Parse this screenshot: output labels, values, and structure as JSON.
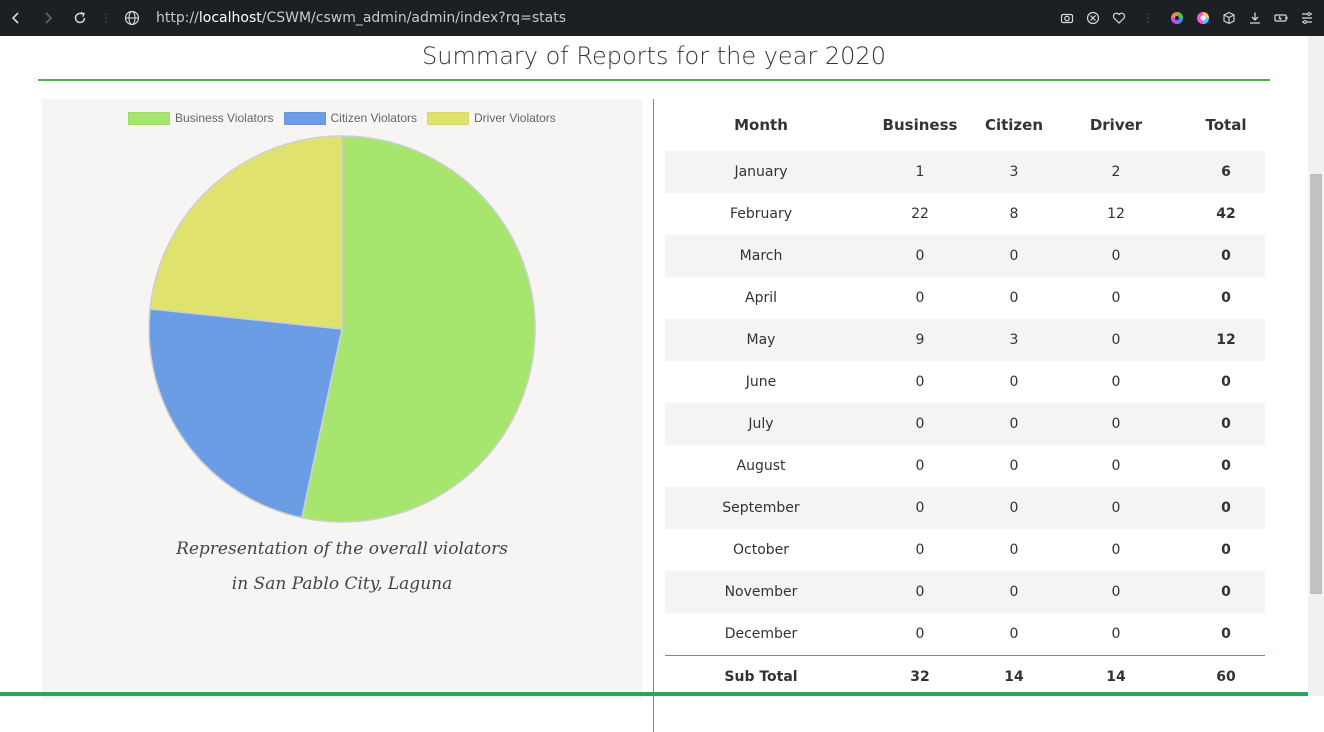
{
  "browser": {
    "url_prefix": "http://",
    "url_host": "localhost",
    "url_path": "/CSWM/cswm_admin/admin/index?rq=stats"
  },
  "page": {
    "title": "Summary of Reports for the year 2020",
    "caption_line1": "Representation of the overall violators",
    "caption_line2": "in San Pablo City, Laguna"
  },
  "chart_data": {
    "type": "pie",
    "categories": [
      "Business Violators",
      "Citizen Violators",
      "Driver Violators"
    ],
    "values": [
      32,
      14,
      14
    ],
    "colors": [
      "#a6e56e",
      "#6b9de4",
      "#dfe36e"
    ],
    "legend": "top",
    "title": ""
  },
  "table": {
    "headers": [
      "Month",
      "Business",
      "Citizen",
      "Driver",
      "Total"
    ],
    "rows": [
      [
        "January",
        "1",
        "3",
        "2",
        "6"
      ],
      [
        "February",
        "22",
        "8",
        "12",
        "42"
      ],
      [
        "March",
        "0",
        "0",
        "0",
        "0"
      ],
      [
        "April",
        "0",
        "0",
        "0",
        "0"
      ],
      [
        "May",
        "9",
        "3",
        "0",
        "12"
      ],
      [
        "June",
        "0",
        "0",
        "0",
        "0"
      ],
      [
        "July",
        "0",
        "0",
        "0",
        "0"
      ],
      [
        "August",
        "0",
        "0",
        "0",
        "0"
      ],
      [
        "September",
        "0",
        "0",
        "0",
        "0"
      ],
      [
        "October",
        "0",
        "0",
        "0",
        "0"
      ],
      [
        "November",
        "0",
        "0",
        "0",
        "0"
      ],
      [
        "December",
        "0",
        "0",
        "0",
        "0"
      ]
    ],
    "subtotal": [
      "Sub Total",
      "32",
      "14",
      "14",
      "60"
    ]
  },
  "colors": {
    "accent": "#4caf50",
    "chrome": "#1c2024"
  }
}
